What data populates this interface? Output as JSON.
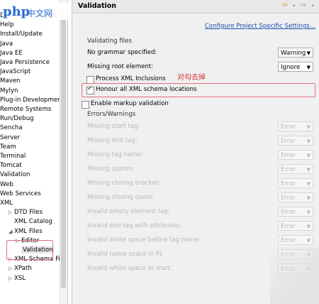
{
  "tree": {
    "items": [
      {
        "label": "Data Management",
        "lvl": 0
      },
      {
        "label": "Help",
        "lvl": 0
      },
      {
        "label": "Install/Update",
        "lvl": 0
      },
      {
        "label": "Java",
        "lvl": 0
      },
      {
        "label": "Java EE",
        "lvl": 0
      },
      {
        "label": "Java Persistence",
        "lvl": 0
      },
      {
        "label": "JavaScript",
        "lvl": 0
      },
      {
        "label": "Maven",
        "lvl": 0
      },
      {
        "label": "Mylyn",
        "lvl": 0
      },
      {
        "label": "Plug-in Development",
        "lvl": 0
      },
      {
        "label": "Remote Systems",
        "lvl": 0
      },
      {
        "label": "Run/Debug",
        "lvl": 0
      },
      {
        "label": "Sencha",
        "lvl": 0
      },
      {
        "label": "Server",
        "lvl": 0
      },
      {
        "label": "Team",
        "lvl": 0
      },
      {
        "label": "Terminal",
        "lvl": 0
      },
      {
        "label": "Tomcat",
        "lvl": 0
      },
      {
        "label": "Validation",
        "lvl": 0
      },
      {
        "label": "Web",
        "lvl": 0
      },
      {
        "label": "Web Services",
        "lvl": 0
      },
      {
        "label": "XML",
        "lvl": 0
      },
      {
        "label": "DTD Files",
        "lvl": 1,
        "arrow": "▷"
      },
      {
        "label": "XML Catalog",
        "lvl": 1
      },
      {
        "label": "XML Files",
        "lvl": 1,
        "arrow": "◢"
      },
      {
        "label": "Editor",
        "lvl": 2,
        "arrow": "▷"
      },
      {
        "label": "Validation",
        "lvl": 2,
        "selected": true
      },
      {
        "label": "XML Schema Files",
        "lvl": 1,
        "arrow": "▷"
      },
      {
        "label": "XPath",
        "lvl": 1,
        "arrow": "▷"
      },
      {
        "label": "XSL",
        "lvl": 1,
        "arrow": "▷"
      }
    ]
  },
  "watermark": {
    "logo": "php",
    "text": "中文网"
  },
  "panel": {
    "title": "Validation",
    "nav_back": "⇦",
    "nav_forward": "⇨",
    "configure_link": "Configure Project Specific Settings...",
    "validating_files_label": "Validating files",
    "no_grammar_label": "No grammar specified:",
    "no_grammar_value": "Warning",
    "missing_root_label": "Missing root element:",
    "missing_root_value": "Ignore",
    "process_xinclusions_label": "Process XML Inclusions",
    "honour_schema_label": "Honour all XML schema locations",
    "annotation": "对勾去掉",
    "enable_markup_label": "Enable markup validation",
    "errors_warnings_label": "Errors/Warnings",
    "error_rows": [
      {
        "label": "Missing start tag:",
        "value": "Error"
      },
      {
        "label": "Missing end tag:",
        "value": "Error"
      },
      {
        "label": "Missing tag name:",
        "value": "Error"
      },
      {
        "label": "Missing quotes:",
        "value": "Error"
      },
      {
        "label": "Missing closing bracket:",
        "value": "Error"
      },
      {
        "label": "Missing closing quote:",
        "value": "Error"
      },
      {
        "label": "Invalid empty element tag:",
        "value": "Error"
      },
      {
        "label": "Invalid end tag with attributes:",
        "value": "Error"
      },
      {
        "label": "Invalid white space before tag name:",
        "value": "Error"
      },
      {
        "label": "Invalid name space in PI:",
        "value": "Error"
      },
      {
        "label": "Invalid white space at start:",
        "value": "Error"
      }
    ]
  }
}
